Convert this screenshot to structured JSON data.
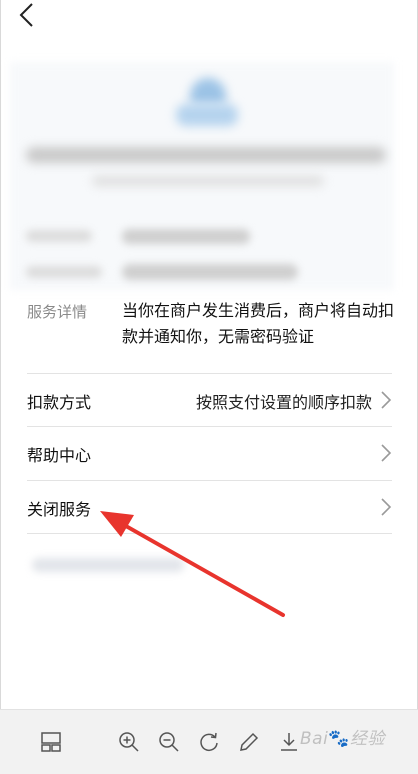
{
  "service": {
    "detail_label": "服务详情",
    "detail_text": "当你在商户发生消费后，商户将自动扣款并通知你，无需密码验证"
  },
  "rows": [
    {
      "label": "扣款方式",
      "value": "按照支付设置的顺序扣款"
    },
    {
      "label": "帮助中心",
      "value": ""
    },
    {
      "label": "关闭服务",
      "value": ""
    }
  ],
  "toolbar": {
    "icons": [
      "layout-icon",
      "zoom-in-icon",
      "zoom-out-icon",
      "rotate-icon",
      "edit-pencil-icon",
      "download-icon"
    ]
  },
  "watermark": {
    "text": "Bai",
    "paw": "🐾",
    "suffix": "经验"
  },
  "colors": {
    "arrow": "#e8342d",
    "divider": "#e3e3e3",
    "label_gray": "#8a8a8a"
  }
}
